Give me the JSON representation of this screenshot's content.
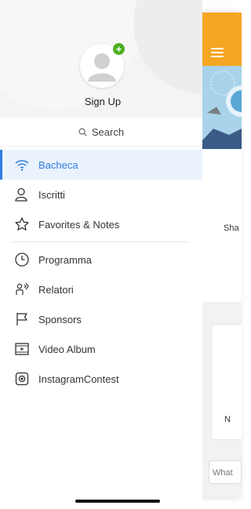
{
  "drawer": {
    "signup_label": "Sign Up",
    "search_label": "Search",
    "items": [
      {
        "label": "Bacheca",
        "icon": "wifi-icon",
        "active": true
      },
      {
        "label": "Iscritti",
        "icon": "user-icon"
      },
      {
        "label": "Favorites & Notes",
        "icon": "star-icon"
      },
      {
        "label": "Programma",
        "icon": "clock-icon"
      },
      {
        "label": "Relatori",
        "icon": "speaker-icon"
      },
      {
        "label": "Sponsors",
        "icon": "flag-icon"
      },
      {
        "label": "Video Album",
        "icon": "video-icon"
      },
      {
        "label": "InstagramContest",
        "icon": "instagram-icon"
      }
    ]
  },
  "app": {
    "partial_text_1": "Sha",
    "partial_text_2": "N",
    "compose_placeholder": "What"
  },
  "colors": {
    "accent": "#2f7de1",
    "app_bar": "#f5a623",
    "badge": "#4caf1e"
  }
}
